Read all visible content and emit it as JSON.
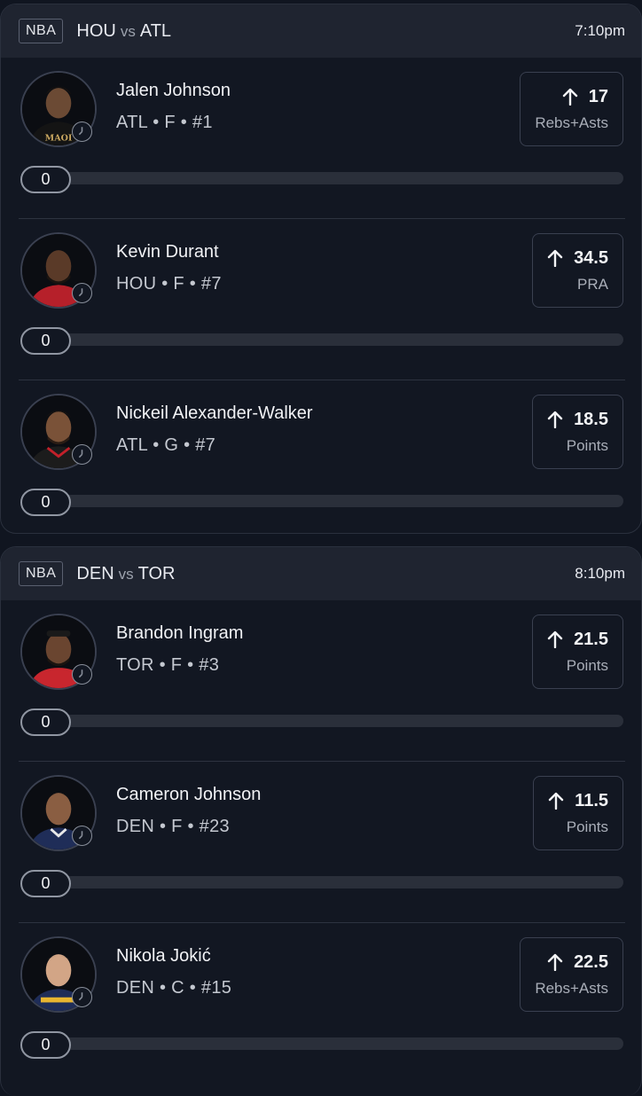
{
  "games": [
    {
      "league": "NBA",
      "team_a": "HOU",
      "vs": "vs",
      "team_b": "ATL",
      "time": "7:10pm",
      "players": [
        {
          "name": "Jalen Johnson",
          "meta": "ATL • F • #1",
          "line": "17",
          "stat": "Rebs+Asts",
          "progress": "0"
        },
        {
          "name": "Kevin Durant",
          "meta": "HOU • F • #7",
          "line": "34.5",
          "stat": "PRA",
          "progress": "0"
        },
        {
          "name": "Nickeil Alexander-Walker",
          "meta": "ATL • G • #7",
          "line": "18.5",
          "stat": "Points",
          "progress": "0"
        }
      ]
    },
    {
      "league": "NBA",
      "team_a": "DEN",
      "vs": "vs",
      "team_b": "TOR",
      "time": "8:10pm",
      "players": [
        {
          "name": "Brandon Ingram",
          "meta": "TOR • F • #3",
          "line": "21.5",
          "stat": "Points",
          "progress": "0"
        },
        {
          "name": "Cameron Johnson",
          "meta": "DEN • F • #23",
          "line": "11.5",
          "stat": "Points",
          "progress": "0"
        },
        {
          "name": "Nikola Jokić",
          "meta": "DEN • C • #15",
          "line": "22.5",
          "stat": "Rebs+Asts",
          "progress": "0"
        }
      ]
    }
  ],
  "icons": {
    "direction": "arrow-up-icon",
    "status": "clock-icon"
  },
  "colors": {
    "background": "#101520",
    "header": "#1f2430",
    "track": "#2a2f3a"
  }
}
